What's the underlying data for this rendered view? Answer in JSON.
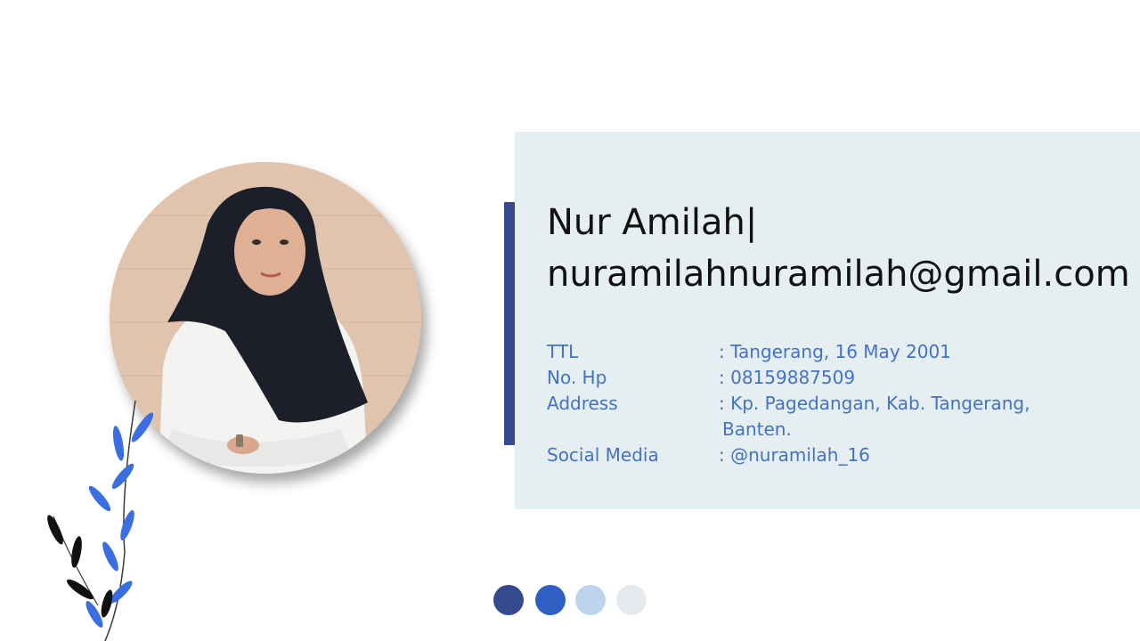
{
  "profile": {
    "name": "Nur Amilah|",
    "email": "nuramilahnuramilah@gmail.com",
    "details": [
      {
        "label": "TTL",
        "value": ": Tangerang, 16 May 2001"
      },
      {
        "label": "No. Hp",
        "value": ": 08159887509"
      },
      {
        "label": "Address",
        "value": ": Kp. Pagedangan, Kab. Tangerang,",
        "continuation": "Banten."
      },
      {
        "label": "Social Media",
        "value": ": @nuramilah_16"
      }
    ]
  },
  "colors": {
    "panel": "#e5eef0",
    "accent": "#35498f",
    "detail_text": "#4472c4",
    "dots": [
      "#35498f",
      "#2f5fc4",
      "#bcd4ec",
      "#e5eaee"
    ]
  }
}
